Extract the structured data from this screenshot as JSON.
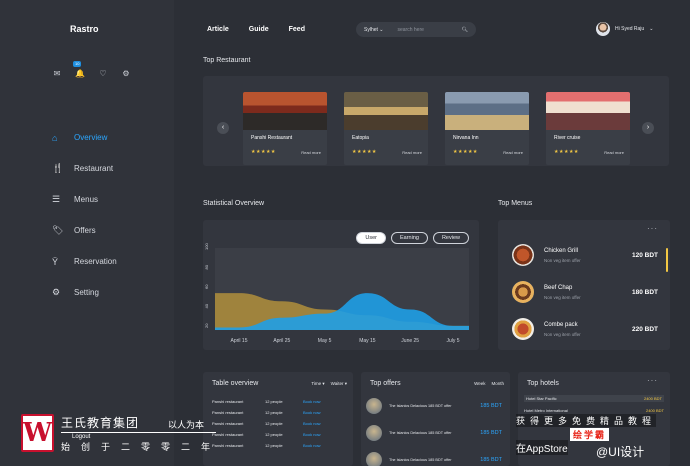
{
  "brand": {
    "prefix": "Ras",
    "suffix": "tro"
  },
  "sidebar": {
    "icons": [
      {
        "name": "mail-icon",
        "glyph": "✉"
      },
      {
        "name": "bell-icon",
        "glyph": "🔔",
        "badge": "10"
      },
      {
        "name": "heart-icon",
        "glyph": "♡"
      },
      {
        "name": "gear-icon",
        "glyph": "⚙"
      }
    ],
    "items": [
      {
        "label": "Overview",
        "icon": "home-icon",
        "glyph": "⌂",
        "active": true
      },
      {
        "label": "Restaurant",
        "icon": "cutlery-icon",
        "glyph": "🍴"
      },
      {
        "label": "Menus",
        "icon": "menu-icon",
        "glyph": "☰"
      },
      {
        "label": "Offers",
        "icon": "tag-icon",
        "glyph": "🏷"
      },
      {
        "label": "Reservation",
        "icon": "reservation-icon",
        "glyph": "Ÿ"
      },
      {
        "label": "Setting",
        "icon": "gear-icon",
        "glyph": "⚙"
      }
    ]
  },
  "topnav": {
    "items": [
      "Article",
      "Guide",
      "Feed"
    ]
  },
  "search": {
    "city": "Sylhet",
    "placeholder": "search here"
  },
  "user": {
    "name": "Hi Syed Raju"
  },
  "top_restaurant": {
    "title": "Top Restaurant",
    "cards": [
      {
        "name": "Panshi Restaurant",
        "stars": "★★★★★",
        "more": "Read more"
      },
      {
        "name": "Eatopia",
        "stars": "★★★★★",
        "more": "Read more"
      },
      {
        "name": "Nirvana Inn",
        "stars": "★★★★★",
        "more": "Read more"
      },
      {
        "name": "River cruise",
        "stars": "★★★★★",
        "more": "Read more"
      }
    ]
  },
  "statistical": {
    "title": "Statistical Overview",
    "tabs": [
      "User",
      "Earning",
      "Review"
    ],
    "y_ticks": [
      "100",
      "80",
      "60",
      "40",
      "20"
    ],
    "x_ticks": [
      "April 15",
      "April 25",
      "May 5",
      "May 15",
      "June 25",
      "July 5"
    ]
  },
  "chart_data": {
    "type": "area",
    "x": [
      "April 15",
      "April 25",
      "May 5",
      "May 15",
      "June 25",
      "July 5"
    ],
    "ylim": [
      0,
      100
    ],
    "series": [
      {
        "values": [
          45,
          35,
          25,
          18,
          10,
          5
        ],
        "color": "#b28f3c"
      },
      {
        "values": [
          3,
          15,
          20,
          45,
          25,
          5
        ],
        "color": "#1f9fe6"
      }
    ]
  },
  "top_menus": {
    "title": "Top Menus",
    "more": "···",
    "items": [
      {
        "name": "Chicken Grill",
        "sub": "Non veg item offer",
        "price": "120 BDT"
      },
      {
        "name": "Beef Chap",
        "sub": "Non veg item offer",
        "price": "180 BDT"
      },
      {
        "name": "Combe pack",
        "sub": "Non veg item offer",
        "price": "220 BDT"
      }
    ]
  },
  "table_overview": {
    "title": "Table overview",
    "filters": [
      "Time ▾",
      "Waiter ▾"
    ],
    "rows": [
      [
        "Panshi restaurant",
        "12 people",
        "Book now"
      ],
      [
        "Panshi restaurant",
        "12 people",
        "Book now"
      ],
      [
        "Panshi restaurant",
        "12 people",
        "Book now"
      ],
      [
        "Panshi restaurant",
        "12 people",
        "Book now"
      ],
      [
        "Panshi restaurant",
        "12 people",
        "Book now"
      ]
    ]
  },
  "top_offers": {
    "title": "Top offers",
    "filters": [
      "Week",
      "Month"
    ],
    "rows": [
      {
        "text": "The Islanics Delacious 185 BDT offer",
        "price": "185 BDT"
      },
      {
        "text": "The Islanics Delacious 185 BDT offer",
        "price": "185 BDT"
      },
      {
        "text": "The Islanics Delacious 185 BDT offer",
        "price": "185 BDT"
      }
    ]
  },
  "top_hotels": {
    "title": "Top hotels",
    "more": "···",
    "rows": [
      {
        "name": "Hotel Star Pacific",
        "price": "2400 BDT"
      },
      {
        "name": "Hotel Metro International",
        "price": "2400 BDT"
      }
    ]
  },
  "overlay": {
    "logo": "W",
    "company": "王氏教育集团",
    "slogan": "以人为本",
    "sub": "始创于二零零二年",
    "logout": "Logout",
    "right1": "获得更多免费精品教程",
    "right2": "绘学霸",
    "right3": "在AppStore",
    "watermark": "@UI设计"
  }
}
